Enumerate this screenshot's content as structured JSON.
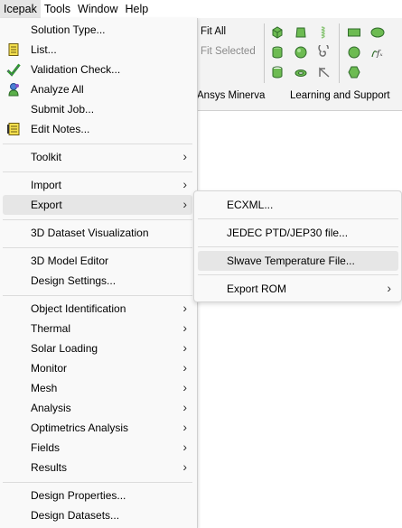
{
  "menubar": {
    "items": [
      {
        "label": "Icepak"
      },
      {
        "label": "Tools"
      },
      {
        "label": "Window"
      },
      {
        "label": "Help"
      }
    ]
  },
  "ribbon": {
    "fit_all": "Fit All",
    "fit_selected": "Fit Selected",
    "group_minerva": "Ansys Minerva",
    "group_learning": "Learning and Support",
    "colors": {
      "shape_green": "#6dbb52",
      "shape_dark": "#2f6b2a"
    }
  },
  "menu": {
    "items": [
      {
        "label": "Solution Type...",
        "icon": "",
        "submenu": false
      },
      {
        "label": "List...",
        "icon": "list-icon",
        "submenu": false
      },
      {
        "label": "Validation Check...",
        "icon": "checkmark-icon",
        "submenu": false
      },
      {
        "label": "Analyze All",
        "icon": "analyze-all-icon",
        "submenu": false
      },
      {
        "label": "Submit Job...",
        "icon": "",
        "submenu": false
      },
      {
        "label": "Edit Notes...",
        "icon": "notes-icon",
        "submenu": false
      },
      {
        "label": "Toolkit",
        "submenu": true
      },
      {
        "label": "Import",
        "submenu": true
      },
      {
        "label": "Export",
        "submenu": true,
        "highlighted": true
      },
      {
        "label": "3D Dataset Visualization",
        "submenu": false
      },
      {
        "label": "3D Model Editor",
        "submenu": false
      },
      {
        "label": "Design Settings...",
        "submenu": false
      },
      {
        "label": "Object Identification",
        "submenu": true
      },
      {
        "label": "Thermal",
        "submenu": true
      },
      {
        "label": "Solar Loading",
        "submenu": true
      },
      {
        "label": "Monitor",
        "submenu": true
      },
      {
        "label": "Mesh",
        "submenu": true
      },
      {
        "label": "Analysis",
        "submenu": true
      },
      {
        "label": "Optimetrics Analysis",
        "submenu": true
      },
      {
        "label": "Fields",
        "submenu": true
      },
      {
        "label": "Results",
        "submenu": true
      },
      {
        "label": "Design Properties...",
        "submenu": false
      },
      {
        "label": "Design Datasets...",
        "submenu": false
      }
    ],
    "submenu_arrow": "›"
  },
  "export_submenu": {
    "items": [
      {
        "label": "ECXML...",
        "submenu": false
      },
      {
        "label": "JEDEC PTD/JEP30 file...",
        "submenu": false
      },
      {
        "label": "Slwave Temperature File...",
        "submenu": false,
        "highlighted": true
      },
      {
        "label": "Export ROM",
        "submenu": true
      }
    ]
  },
  "colors": {
    "menu_bg": "#f9f9f9",
    "highlight": "#e6e6e6",
    "separator": "#dcdcdc"
  }
}
